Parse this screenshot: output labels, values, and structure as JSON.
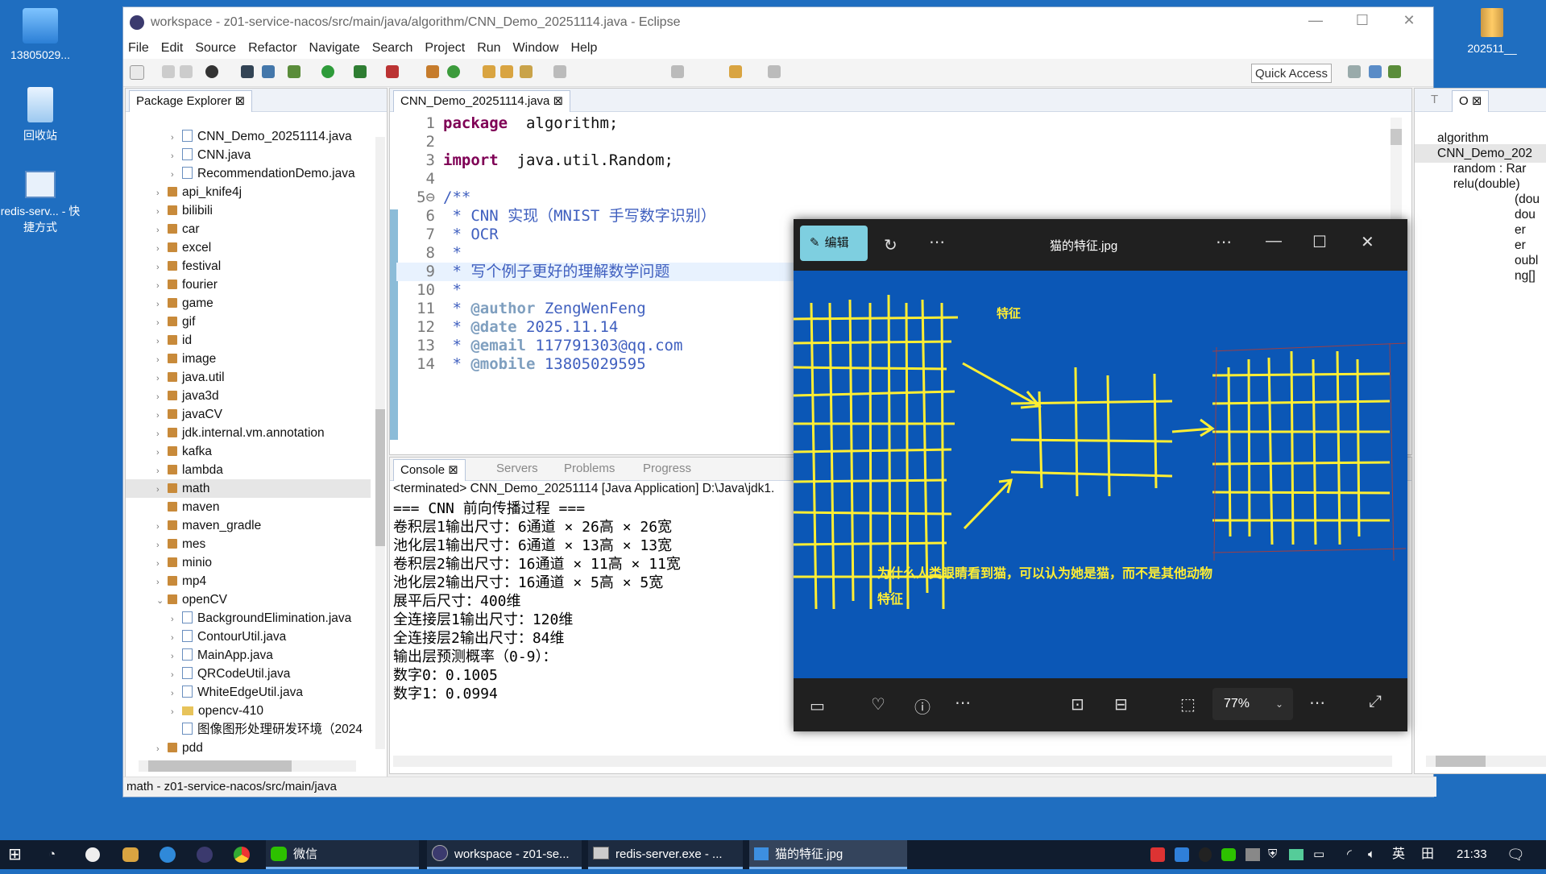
{
  "desktop": {
    "icons": [
      {
        "label": "13805029..."
      },
      {
        "label": "回收站"
      },
      {
        "label": "redis-serv... - 快捷方式"
      },
      {
        "label": "202511__"
      }
    ]
  },
  "eclipse": {
    "title": "workspace - z01-service-nacos/src/main/java/algorithm/CNN_Demo_20251114.java - Eclipse",
    "menu": [
      "File",
      "Edit",
      "Source",
      "Refactor",
      "Navigate",
      "Search",
      "Project",
      "Run",
      "Window",
      "Help"
    ],
    "quick_access": "Quick Access",
    "package_explorer": {
      "tab": "Package Explorer",
      "items": [
        {
          "label": "CNN_Demo_20251114.java",
          "type": "file",
          "indent": 2,
          "arrow": "›"
        },
        {
          "label": "CNN.java",
          "type": "file",
          "indent": 2,
          "arrow": "›"
        },
        {
          "label": "RecommendationDemo.java",
          "type": "file",
          "indent": 2,
          "arrow": "›"
        },
        {
          "label": "api_knife4j",
          "type": "pkg",
          "indent": 1,
          "arrow": "›"
        },
        {
          "label": "bilibili",
          "type": "pkg",
          "indent": 1,
          "arrow": "›"
        },
        {
          "label": "car",
          "type": "pkg",
          "indent": 1,
          "arrow": "›"
        },
        {
          "label": "excel",
          "type": "pkg",
          "indent": 1,
          "arrow": "›"
        },
        {
          "label": "festival",
          "type": "pkg",
          "indent": 1,
          "arrow": "›"
        },
        {
          "label": "fourier",
          "type": "pkg",
          "indent": 1,
          "arrow": "›"
        },
        {
          "label": "game",
          "type": "pkg",
          "indent": 1,
          "arrow": "›"
        },
        {
          "label": "gif",
          "type": "pkg",
          "indent": 1,
          "arrow": "›"
        },
        {
          "label": "id",
          "type": "pkg",
          "indent": 1,
          "arrow": "›"
        },
        {
          "label": "image",
          "type": "pkg",
          "indent": 1,
          "arrow": "›"
        },
        {
          "label": "java.util",
          "type": "pkg",
          "indent": 1,
          "arrow": "›"
        },
        {
          "label": "java3d",
          "type": "pkg",
          "indent": 1,
          "arrow": "›"
        },
        {
          "label": "javaCV",
          "type": "pkg",
          "indent": 1,
          "arrow": "›"
        },
        {
          "label": "jdk.internal.vm.annotation",
          "type": "pkg",
          "indent": 1,
          "arrow": "›"
        },
        {
          "label": "kafka",
          "type": "pkg",
          "indent": 1,
          "arrow": "›"
        },
        {
          "label": "lambda",
          "type": "pkg",
          "indent": 1,
          "arrow": "›"
        },
        {
          "label": "math",
          "type": "pkg",
          "indent": 1,
          "arrow": "›",
          "selected": true
        },
        {
          "label": "maven",
          "type": "pkg",
          "indent": 1,
          "arrow": ""
        },
        {
          "label": "maven_gradle",
          "type": "pkg",
          "indent": 1,
          "arrow": "›"
        },
        {
          "label": "mes",
          "type": "pkg",
          "indent": 1,
          "arrow": "›"
        },
        {
          "label": "minio",
          "type": "pkg",
          "indent": 1,
          "arrow": "›"
        },
        {
          "label": "mp4",
          "type": "pkg",
          "indent": 1,
          "arrow": "›"
        },
        {
          "label": "openCV",
          "type": "pkg",
          "indent": 1,
          "arrow": "⌄"
        },
        {
          "label": "BackgroundElimination.java",
          "type": "file",
          "indent": 2,
          "arrow": "›"
        },
        {
          "label": "ContourUtil.java",
          "type": "file",
          "indent": 2,
          "arrow": "›"
        },
        {
          "label": "MainApp.java",
          "type": "file",
          "indent": 2,
          "arrow": "›"
        },
        {
          "label": "QRCodeUtil.java",
          "type": "file",
          "indent": 2,
          "arrow": "›"
        },
        {
          "label": "WhiteEdgeUtil.java",
          "type": "file",
          "indent": 2,
          "arrow": "›"
        },
        {
          "label": "opencv-410",
          "type": "folder",
          "indent": 2,
          "arrow": "›"
        },
        {
          "label": "图像图形处理研发环境（2024",
          "type": "file",
          "indent": 2,
          "arrow": ""
        },
        {
          "label": "pdd",
          "type": "pkg",
          "indent": 1,
          "arrow": "›"
        }
      ]
    },
    "editor": {
      "tab": "CNN_Demo_20251114.java",
      "lines": [
        {
          "n": "1",
          "html": [
            [
              "kw",
              "package"
            ],
            [
              "",
              "  algorithm;"
            ]
          ]
        },
        {
          "n": "2",
          "html": []
        },
        {
          "n": "3",
          "html": [
            [
              "kw",
              "import"
            ],
            [
              "",
              "  java.util.Random;"
            ]
          ]
        },
        {
          "n": "4",
          "html": []
        },
        {
          "n": "5⊖",
          "html": [
            [
              "cm",
              "/**"
            ]
          ]
        },
        {
          "n": "6",
          "html": [
            [
              "cm",
              " * CNN 实现（MNIST 手写数字识别）"
            ]
          ]
        },
        {
          "n": "7",
          "html": [
            [
              "cm",
              " * OCR"
            ]
          ]
        },
        {
          "n": "8",
          "html": [
            [
              "cm",
              " *"
            ]
          ]
        },
        {
          "n": "9",
          "html": [
            [
              "cm",
              " * 写个例子更好的理解数学问题"
            ]
          ]
        },
        {
          "n": "10",
          "html": [
            [
              "cm",
              " *"
            ]
          ]
        },
        {
          "n": "11",
          "html": [
            [
              "cm",
              " * "
            ],
            [
              "tag",
              "@author"
            ],
            [
              "cm",
              " ZengWenFeng"
            ]
          ]
        },
        {
          "n": "12",
          "html": [
            [
              "cm",
              " * "
            ],
            [
              "tag",
              "@date"
            ],
            [
              "cm",
              " 2025.11.14"
            ]
          ]
        },
        {
          "n": "13",
          "html": [
            [
              "cm",
              " * "
            ],
            [
              "tag",
              "@email"
            ],
            [
              "cm",
              " 117791303@qq.com"
            ]
          ]
        },
        {
          "n": "14",
          "html": [
            [
              "cm",
              " * "
            ],
            [
              "tag",
              "@mobile"
            ],
            [
              "cm",
              " 13805029595"
            ]
          ]
        }
      ]
    },
    "console": {
      "tabs": [
        "Console",
        "Servers",
        "Problems",
        "Progress"
      ],
      "terminated": "<terminated> CNN_Demo_20251114 [Java Application] D:\\Java\\jdk1.",
      "lines": [
        "=== CNN 前向传播过程 ===",
        "卷积层1输出尺寸：6通道 × 26高 × 26宽",
        "池化层1输出尺寸：6通道 × 13高 × 13宽",
        "卷积层2输出尺寸：16通道 × 11高 × 11宽",
        "池化层2输出尺寸：16通道 × 5高 × 5宽",
        "展平后尺寸：400维",
        "全连接层1输出尺寸：120维",
        "全连接层2输出尺寸：84维",
        "输出层预测概率（0-9）：",
        "数字0：0.1005",
        "数字1：0.0994"
      ]
    },
    "outline": {
      "tabs": [
        "T",
        "O"
      ],
      "items": [
        "algorithm",
        "CNN_Demo_202",
        "random : Rar",
        "relu(double)",
        "(dou",
        "dou",
        "er",
        "er",
        "oubl",
        "ng[]"
      ]
    },
    "status": "math - z01-service-nacos/src/main/java"
  },
  "viewer": {
    "edit_label": "编辑",
    "title": "猫的特征.jpg",
    "image_text_top": "特征",
    "image_text_bottom1": "为什么人类眼睛看到猫，可以认为她是猫，而不是其他动物",
    "image_text_bottom2": "特征",
    "zoom": "77%"
  },
  "taskbar": {
    "wechat": "微信",
    "eclipse": "workspace - z01-se...",
    "redis": "redis-server.exe - ...",
    "photo": "猫的特征.jpg",
    "ime": "英",
    "ime2": "田",
    "time": "21:33"
  }
}
